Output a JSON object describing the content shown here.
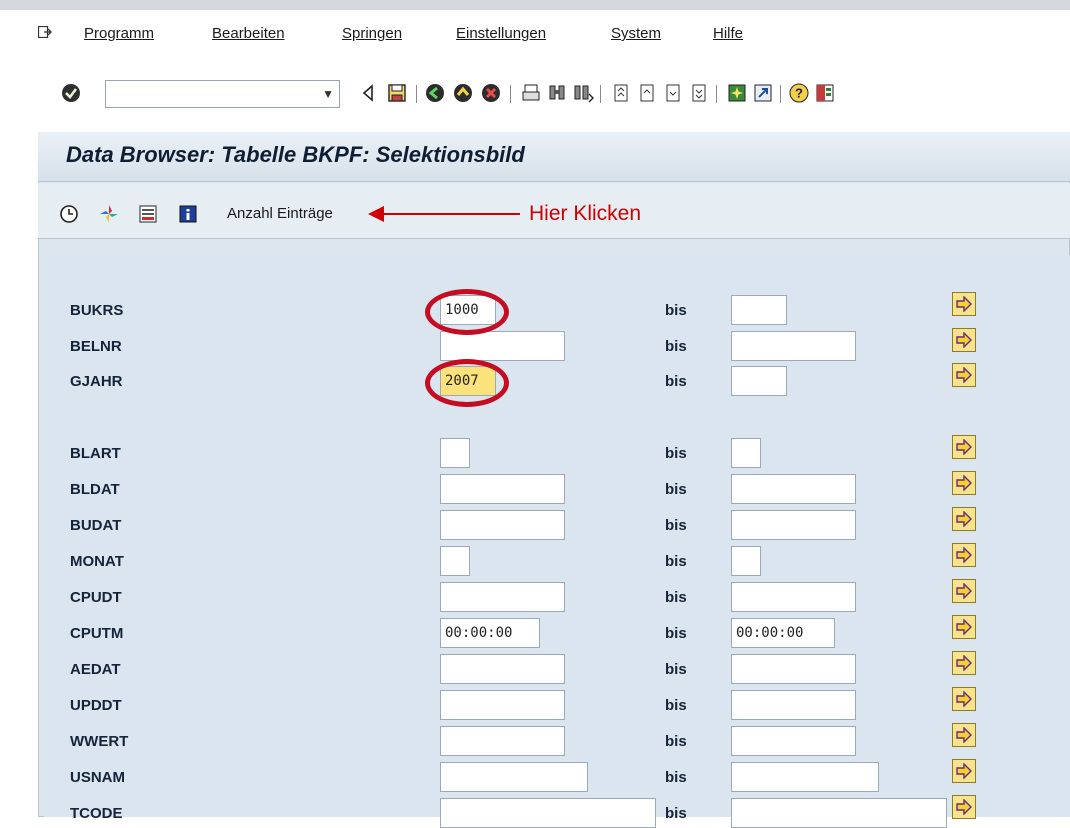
{
  "menubar": {
    "items": [
      {
        "label": "Programm"
      },
      {
        "label": "Bearbeiten"
      },
      {
        "label": "Springen"
      },
      {
        "label": "Einstellungen"
      },
      {
        "label": "System"
      },
      {
        "label": "Hilfe"
      }
    ]
  },
  "toolbar": {
    "command_field_value": "",
    "icons": [
      "enter-icon",
      "back-icon",
      "save-icon",
      "green-back-icon",
      "exit-icon",
      "cancel-icon",
      "print-icon",
      "find-icon",
      "find-next-icon",
      "first-page-icon",
      "prev-page-icon",
      "next-page-icon",
      "last-page-icon",
      "new-session-icon",
      "shortcut-icon",
      "help-icon",
      "layout-icon"
    ]
  },
  "page": {
    "title": "Data Browser: Tabelle BKPF: Selektionsbild"
  },
  "app_toolbar": {
    "count_entries_label": "Anzahl Einträge",
    "annotation_text": "Hier Klicken",
    "annotation_color": "#d00000"
  },
  "selection": {
    "bis_label": "bis",
    "fields": [
      {
        "name": "BUKRS",
        "from": "1000",
        "to": "",
        "highlight": false
      },
      {
        "name": "BELNR",
        "from": "",
        "to": "",
        "highlight": false
      },
      {
        "name": "GJAHR",
        "from": "2007",
        "to": "",
        "highlight": true
      },
      {
        "name": "BLART",
        "from": "",
        "to": "",
        "highlight": false
      },
      {
        "name": "BLDAT",
        "from": "",
        "to": "",
        "highlight": false
      },
      {
        "name": "BUDAT",
        "from": "",
        "to": "",
        "highlight": false
      },
      {
        "name": "MONAT",
        "from": "",
        "to": "",
        "highlight": false
      },
      {
        "name": "CPUDT",
        "from": "",
        "to": "",
        "highlight": false
      },
      {
        "name": "CPUTM",
        "from": "00:00:00",
        "to": "00:00:00",
        "highlight": false
      },
      {
        "name": "AEDAT",
        "from": "",
        "to": "",
        "highlight": false
      },
      {
        "name": "UPDDT",
        "from": "",
        "to": "",
        "highlight": false
      },
      {
        "name": "WWERT",
        "from": "",
        "to": "",
        "highlight": false
      },
      {
        "name": "USNAM",
        "from": "",
        "to": "",
        "highlight": false
      },
      {
        "name": "TCODE",
        "from": "",
        "to": "",
        "highlight": false
      }
    ]
  },
  "colors": {
    "highlight_field": "#fbe27a",
    "annotation_circle": "#c40d23",
    "panel_bg": "#dbe5ef"
  }
}
